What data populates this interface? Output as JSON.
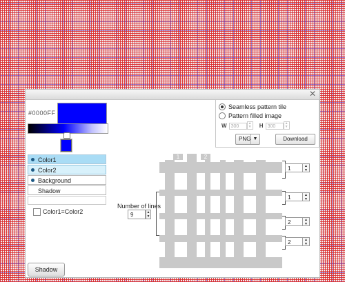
{
  "left_panel": {
    "hex_value": "#0000FF",
    "swatch_color": "#0000ff",
    "color_list": [
      {
        "label": "Color1",
        "dot": true
      },
      {
        "label": "Color2",
        "dot": true
      },
      {
        "label": "Background",
        "dot": true
      },
      {
        "label": "Shadow",
        "dot": false
      }
    ],
    "checkbox_label": "Color1=Color2",
    "checkbox_checked": false,
    "shadow_button": "Shadow"
  },
  "export_panel": {
    "option_seamless": "Seamless pattern tile",
    "option_filled": "Pattern filled image",
    "selected_option": "Seamless pattern tile",
    "width_label": "W",
    "width_value": "300",
    "height_label": "H",
    "height_value": "300",
    "format_value": "PNG",
    "download_button": "Download"
  },
  "pattern_editor": {
    "number_of_lines_label": "Number of lines",
    "number_of_lines_value": "9",
    "column_tabs": [
      "1",
      "2"
    ],
    "row_values": [
      "1",
      "1",
      "2",
      "2"
    ],
    "pattern_color": "#c9c9c9"
  },
  "icons": {
    "close": "close-icon",
    "spinner_up": "spinner-up-icon",
    "spinner_down": "spinner-down-icon",
    "dropdown": "chevron-down-icon"
  }
}
